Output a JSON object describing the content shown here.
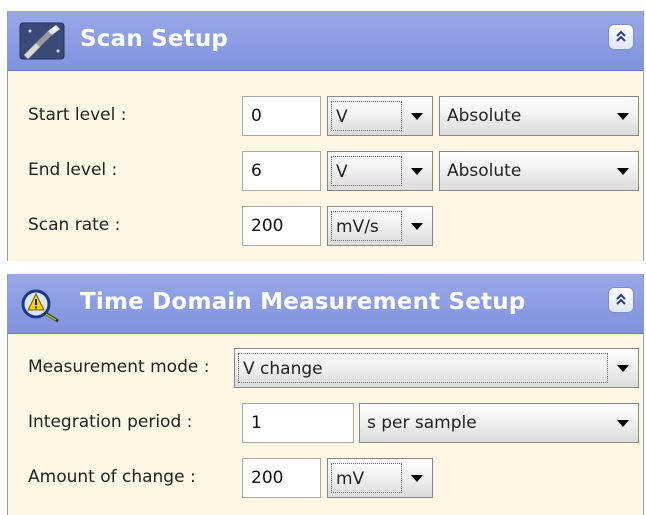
{
  "scan_setup": {
    "title": "Scan Setup",
    "icon": "probe-icon",
    "collapse_icon": "double-chevron-up-icon",
    "rows": [
      {
        "label": "Start level :",
        "value": "0",
        "unit": "V",
        "mode": "Absolute"
      },
      {
        "label": "End level :",
        "value": "6",
        "unit": "V",
        "mode": "Absolute"
      },
      {
        "label": "Scan rate :",
        "value": "200",
        "unit": "mV/s"
      }
    ]
  },
  "time_domain": {
    "title": "Time Domain Measurement Setup",
    "icon": "measurement-icon",
    "collapse_icon": "double-chevron-up-icon",
    "measurement_mode": {
      "label": "Measurement mode :",
      "value": "V change"
    },
    "integration_period": {
      "label": "Integration period :",
      "value": "1",
      "unit": "s per sample"
    },
    "amount_of_change": {
      "label": "Amount of change :",
      "value": "200",
      "unit": "mV"
    }
  },
  "colors": {
    "header_bg": "#8a9ae2",
    "panel_bg": "#fdf7e3",
    "header_text": "#ffffff"
  }
}
